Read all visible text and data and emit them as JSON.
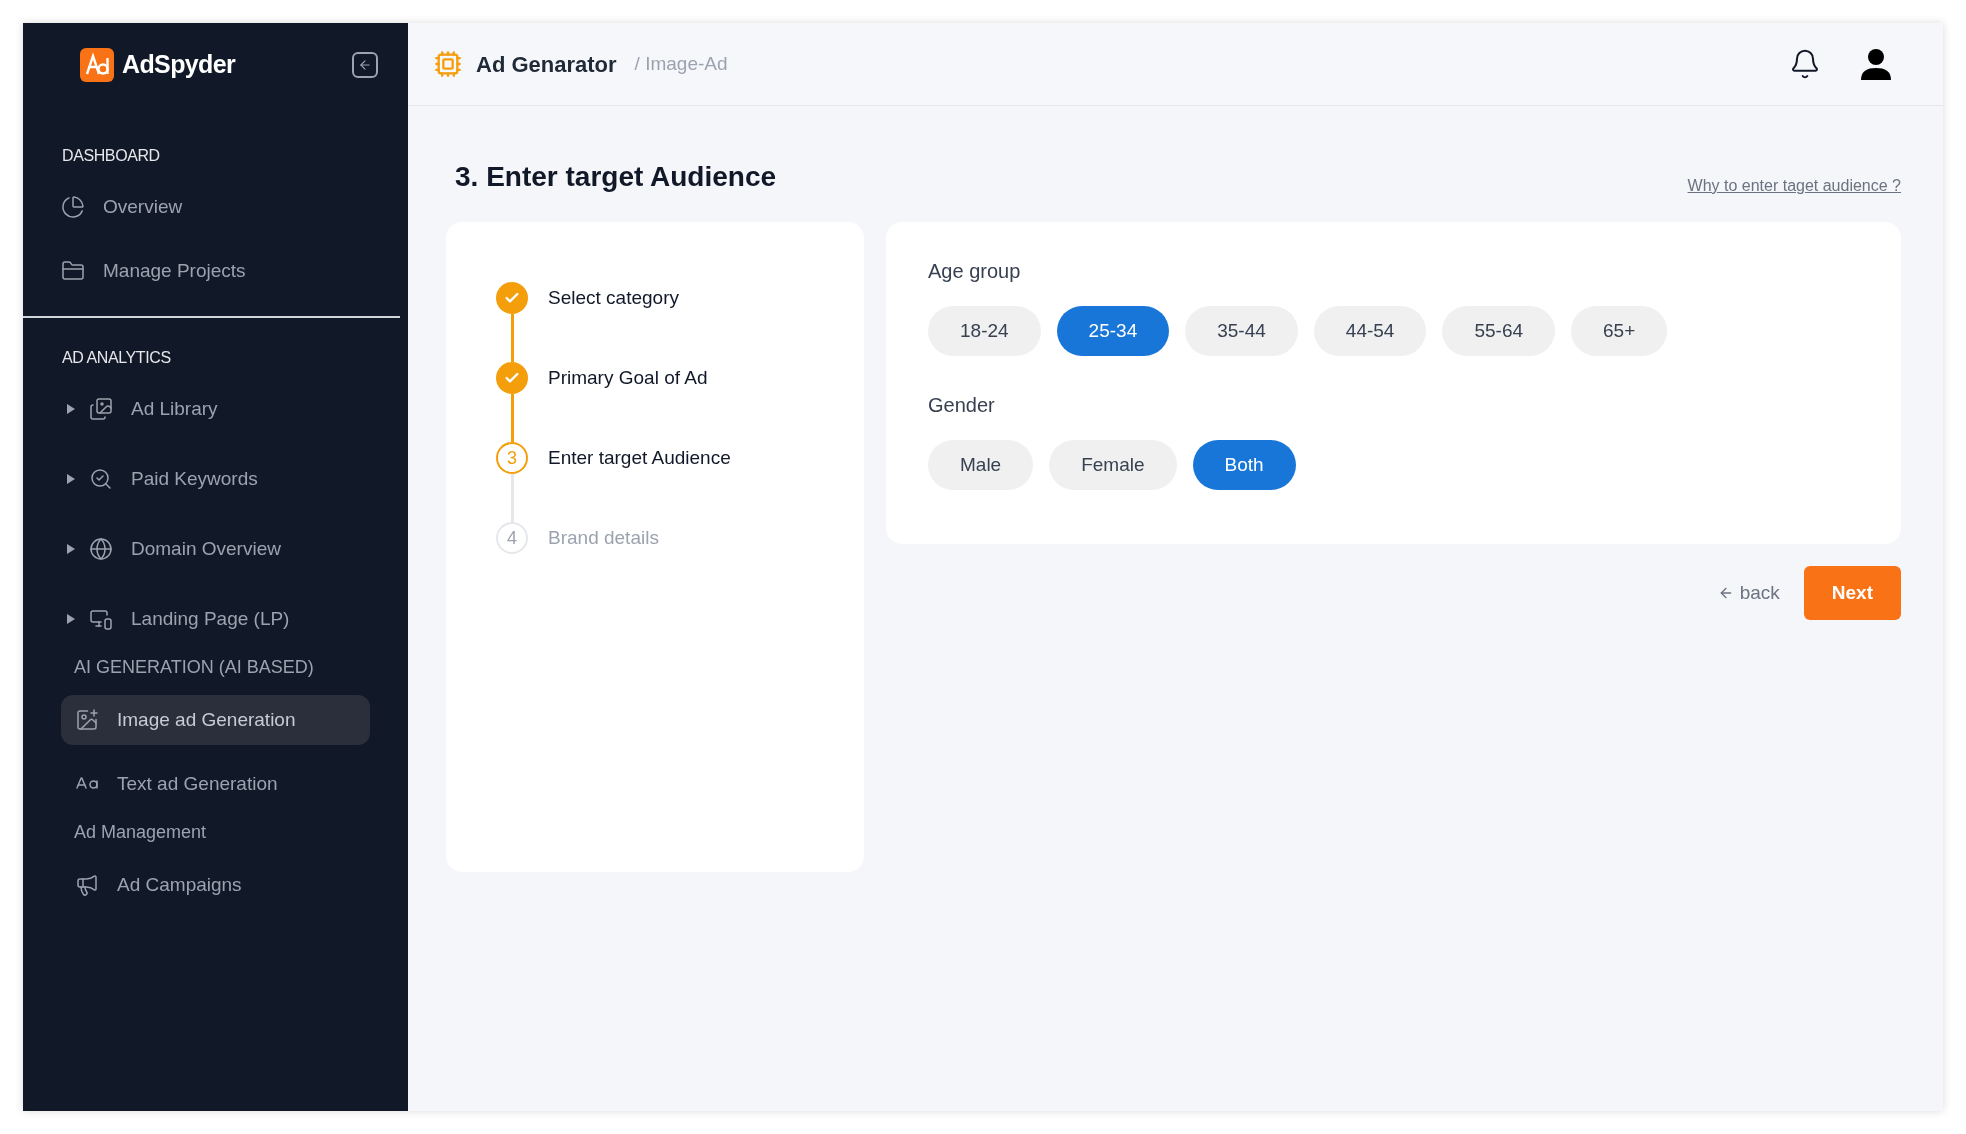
{
  "sidebar": {
    "brand": "AdSpyder",
    "sections": [
      {
        "heading": "DASHBOARD",
        "kind": "primary",
        "items": [
          {
            "label": "Overview",
            "expandable": false,
            "selected": false
          },
          {
            "label": "Manage Projects",
            "expandable": false,
            "selected": false
          }
        ]
      },
      {
        "heading": "AD ANALYTICS",
        "kind": "primary",
        "items": [
          {
            "label": "Ad Library",
            "expandable": true,
            "selected": false
          },
          {
            "label": "Paid Keywords",
            "expandable": true,
            "selected": false
          },
          {
            "label": "Domain Overview",
            "expandable": true,
            "selected": false
          },
          {
            "label": "Landing Page (LP)",
            "expandable": true,
            "selected": false
          }
        ]
      },
      {
        "heading": "AI GENERATION (AI BASED)",
        "kind": "secondary",
        "items": [
          {
            "label": "Image ad Generation",
            "expandable": false,
            "selected": true
          },
          {
            "label": "Text ad Generation",
            "expandable": false,
            "selected": false
          }
        ]
      },
      {
        "heading": "Ad Management",
        "kind": "secondary",
        "items": [
          {
            "label": "Ad Campaigns",
            "expandable": false,
            "selected": false
          }
        ]
      }
    ]
  },
  "header": {
    "title": "Ad Genarator",
    "breadcrumb": "/ Image-Ad"
  },
  "page": {
    "title": "3. Enter target Audience",
    "help_link": "Why to enter taget audience ?"
  },
  "steps": [
    {
      "label": "Select category",
      "done": true,
      "current": false
    },
    {
      "label": "Primary Goal of Ad",
      "done": true,
      "current": false
    },
    {
      "marker": "3",
      "label": "Enter target Audience",
      "done": false,
      "current": true
    },
    {
      "marker": "4",
      "label": "Brand details",
      "done": false,
      "current": false
    }
  ],
  "groups": [
    {
      "label": "Age group",
      "options": [
        {
          "label": "18-24",
          "selected": false
        },
        {
          "label": "25-34",
          "selected": true
        },
        {
          "label": "35-44",
          "selected": false
        },
        {
          "label": "44-54",
          "selected": false
        },
        {
          "label": "55-64",
          "selected": false
        },
        {
          "label": "65+",
          "selected": false
        }
      ]
    },
    {
      "label": "Gender",
      "options": [
        {
          "label": "Male",
          "selected": false
        },
        {
          "label": "Female",
          "selected": false
        },
        {
          "label": "Both",
          "selected": true
        }
      ]
    }
  ],
  "actions": {
    "back": "back",
    "next": "Next"
  }
}
